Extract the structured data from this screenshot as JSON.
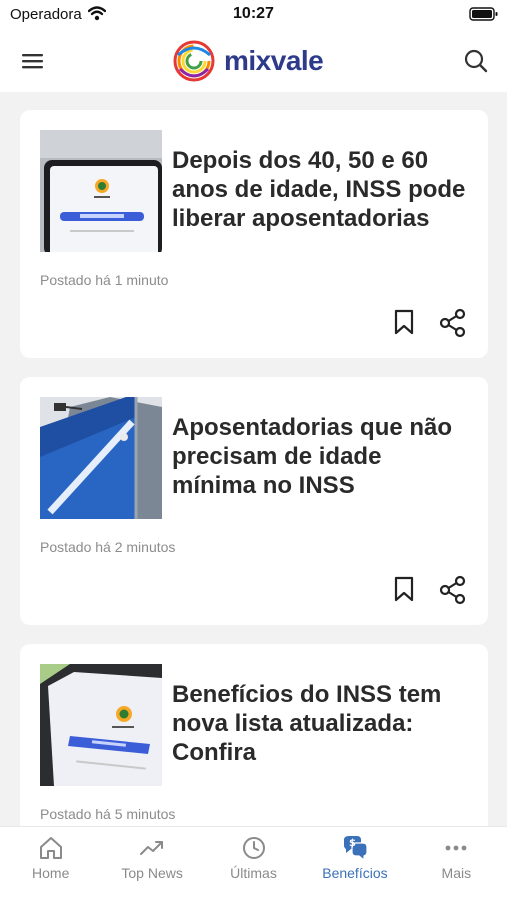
{
  "status_bar": {
    "carrier": "Operadora",
    "time": "10:27"
  },
  "header": {
    "brand_name": "mixvale"
  },
  "articles": [
    {
      "title": "Depois dos 40, 50 e 60 anos de idade, INSS pode liberar aposentadorias",
      "posted": "Postado há 1 minuto"
    },
    {
      "title": "Aposentadorias que não precisam de idade mínima no INSS",
      "posted": "Postado há 2 minutos"
    },
    {
      "title": "Benefícios do INSS tem nova lista atualizada: Confira",
      "posted": "Postado há 5 minutos"
    }
  ],
  "tabs": [
    {
      "label": "Home",
      "icon": "home-icon"
    },
    {
      "label": "Top News",
      "icon": "trending-icon"
    },
    {
      "label": "Últimas",
      "icon": "clock-icon"
    },
    {
      "label": "Benefícios",
      "icon": "dollar-chat-icon"
    },
    {
      "label": "Mais",
      "icon": "more-dots-icon"
    }
  ],
  "active_tab": "Benefícios",
  "colors": {
    "active": "#3b71b8",
    "inactive": "#8a8a8a",
    "brand": "#2d3b8a"
  }
}
